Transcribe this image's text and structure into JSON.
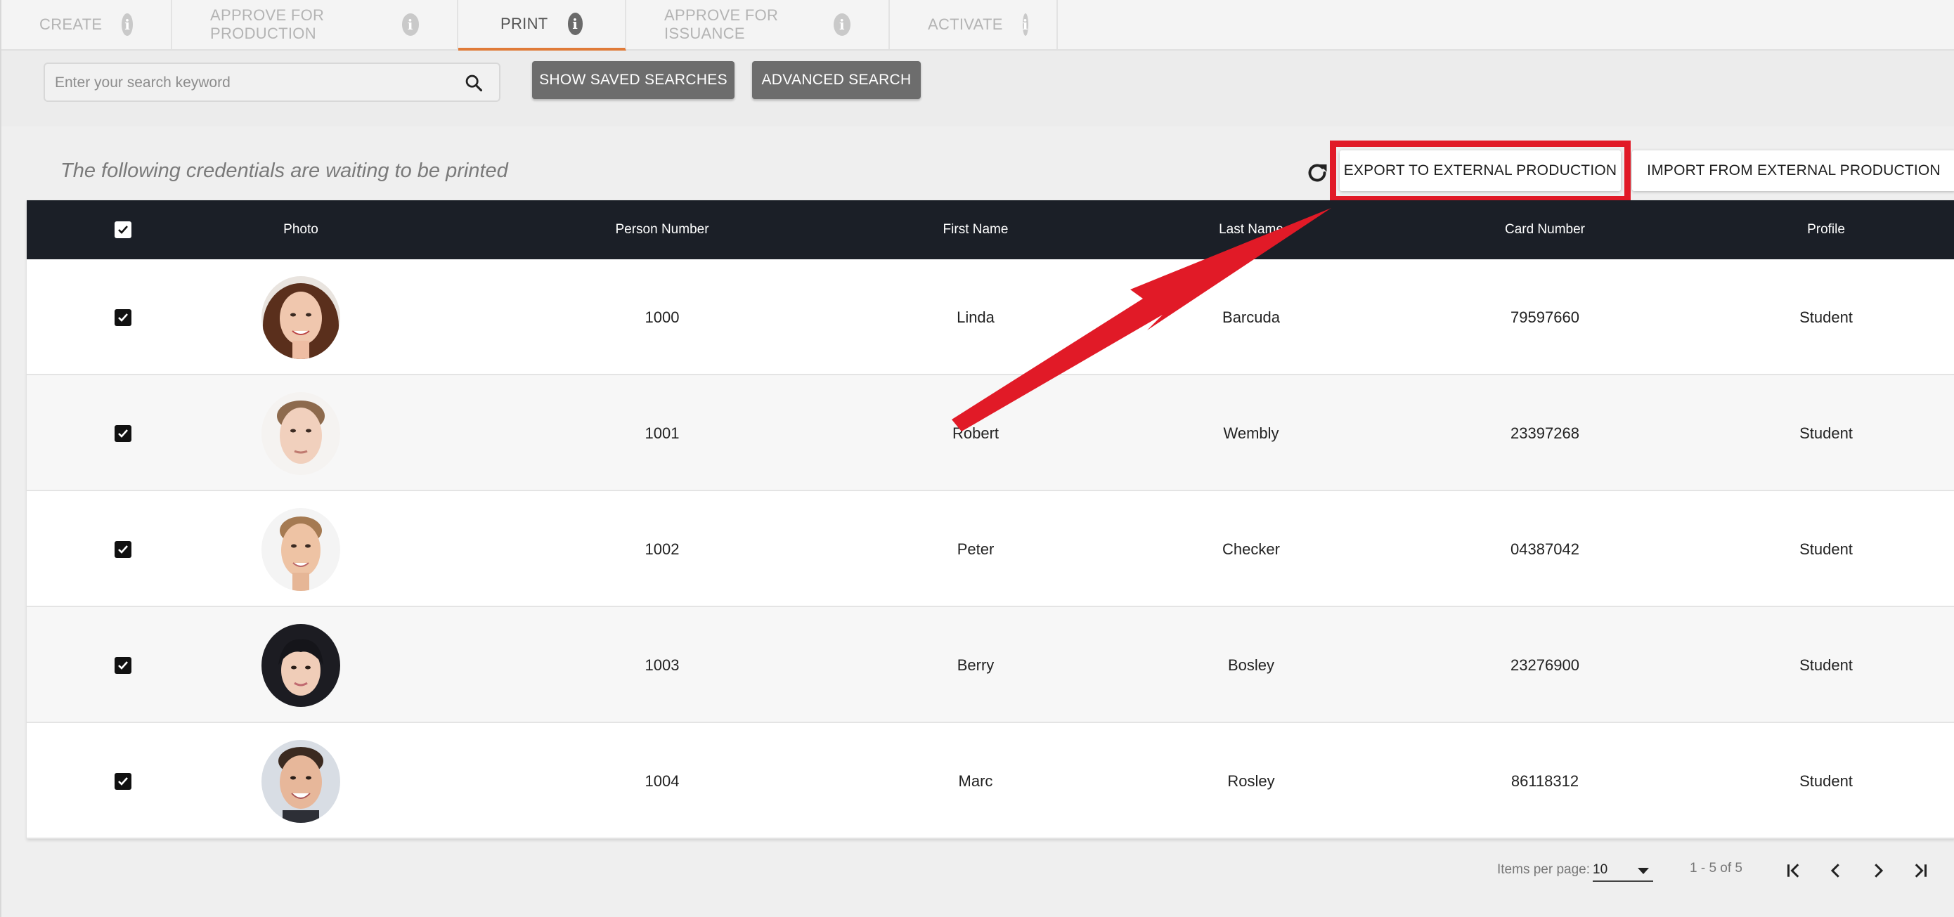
{
  "tabs": [
    {
      "label": "CREATE",
      "active": false
    },
    {
      "label": "APPROVE FOR PRODUCTION",
      "active": false
    },
    {
      "label": "PRINT",
      "active": true
    },
    {
      "label": "APPROVE FOR ISSUANCE",
      "active": false
    },
    {
      "label": "ACTIVATE",
      "active": false
    }
  ],
  "search": {
    "placeholder": "Enter your search keyword",
    "value": "",
    "show_saved_label": "SHOW SAVED SEARCHES",
    "advanced_label": "ADVANCED SEARCH"
  },
  "main": {
    "caption": "The following credentials are waiting to be printed",
    "export_label": "EXPORT TO EXTERNAL PRODUCTION",
    "import_label": "IMPORT FROM EXTERNAL PRODUCTION"
  },
  "table": {
    "headers": {
      "photo": "Photo",
      "person_number": "Person Number",
      "first_name": "First Name",
      "last_name": "Last Name",
      "card_number": "Card Number",
      "profile": "Profile"
    },
    "rows": [
      {
        "person_number": "1000",
        "first_name": "Linda",
        "last_name": "Barcuda",
        "card_number": "79597660",
        "profile": "Student",
        "checked": true
      },
      {
        "person_number": "1001",
        "first_name": "Robert",
        "last_name": "Wembly",
        "card_number": "23397268",
        "profile": "Student",
        "checked": true
      },
      {
        "person_number": "1002",
        "first_name": "Peter",
        "last_name": "Checker",
        "card_number": "04387042",
        "profile": "Student",
        "checked": true
      },
      {
        "person_number": "1003",
        "first_name": "Berry",
        "last_name": "Bosley",
        "card_number": "23276900",
        "profile": "Student",
        "checked": true
      },
      {
        "person_number": "1004",
        "first_name": "Marc",
        "last_name": "Rosley",
        "card_number": "86118312",
        "profile": "Student",
        "checked": true
      }
    ]
  },
  "pagination": {
    "items_per_page_label": "Items per page:",
    "items_per_page_value": "10",
    "range_text": "1 - 5 of 5"
  },
  "colors": {
    "accent": "#e07b39",
    "header_bg": "#1b1f27",
    "annotation_red": "#e11a27",
    "gray_button": "#6d6d6d"
  }
}
